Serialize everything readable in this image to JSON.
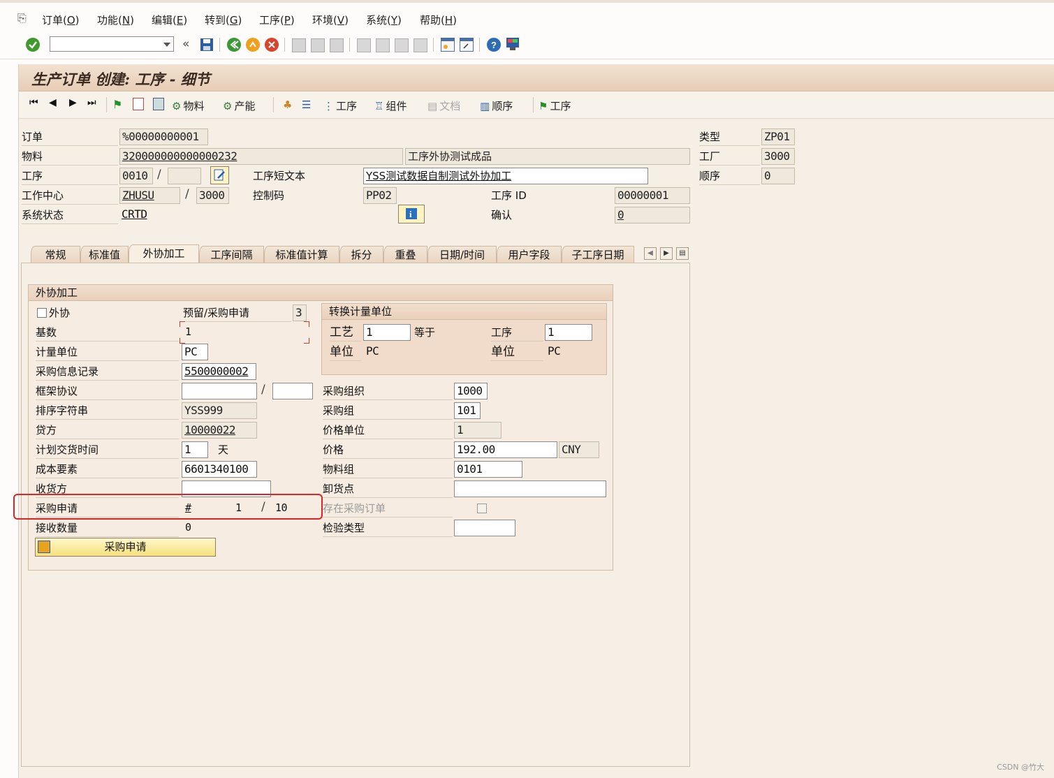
{
  "menu": {
    "items": [
      {
        "label": "订单(",
        "key": "O",
        "tail": ")"
      },
      {
        "label": "功能(",
        "key": "N",
        "tail": ")"
      },
      {
        "label": "编辑(",
        "key": "E",
        "tail": ")"
      },
      {
        "label": "转到(",
        "key": "G",
        "tail": ")"
      },
      {
        "label": "工序(",
        "key": "P",
        "tail": ")"
      },
      {
        "label": "环境(",
        "key": "V",
        "tail": ")"
      },
      {
        "label": "系统(",
        "key": "Y",
        "tail": ")"
      },
      {
        "label": "帮助(",
        "key": "H",
        "tail": ")"
      }
    ]
  },
  "command_field": {
    "value": ""
  },
  "title": "生产订单 创建: 工序 - 细节",
  "app_toolbar": {
    "material": "物料",
    "capacity": "产能",
    "operation": "工序",
    "component": "组件",
    "document": "文档",
    "sequence": "顺序",
    "operation2": "工序"
  },
  "header": {
    "order_label": "订单",
    "order_value": "%00000000001",
    "material_label": "物料",
    "material_value": "320000000000000232",
    "material_desc": "工序外协测试成品",
    "operation_label": "工序",
    "operation_value": "0010",
    "suboperation_value": "",
    "short_text_label": "工序短文本",
    "short_text_value": "YSS测试数据自制测试外协加工",
    "workcenter_label": "工作中心",
    "workcenter_value": "ZHUSU",
    "plant_value_wc": "3000",
    "control_key_label": "控制码",
    "control_key_value": "PP02",
    "op_id_label": "工序 ID",
    "op_id_value": "00000001",
    "status_label": "系统状态",
    "status_value": "CRTD",
    "confirm_label": "确认",
    "confirm_value": "0",
    "type_label": "类型",
    "type_value": "ZP01",
    "plant_label": "工厂",
    "plant_value": "3000",
    "sequence_label": "顺序",
    "sequence_value": "0"
  },
  "tabs": [
    "常规",
    "标准值",
    "外协加工",
    "工序间隔",
    "标准值计算",
    "拆分",
    "重叠",
    "日期/时间",
    "用户字段",
    "子工序日期"
  ],
  "outsourcing": {
    "group_title": "外协加工",
    "external_label": "外协",
    "reservation_label": "预留/采购申请",
    "reservation_value": "3",
    "base_qty_label": "基数",
    "base_qty_value": "1",
    "uom_label": "计量单位",
    "uom_value": "PC",
    "info_record_label": "采购信息记录",
    "info_record_value": "5500000002",
    "outline_label": "框架协议",
    "outline_value": "",
    "outline_item": "",
    "sort_label": "排序字符串",
    "sort_value": "YSS999",
    "vendor_label": "贷方",
    "vendor_value": "10000022",
    "delivery_label": "计划交货时间",
    "delivery_value": "1",
    "delivery_unit": "天",
    "cost_element_label": "成本要素",
    "cost_element_value": "6601340100",
    "recipient_label": "收货方",
    "recipient_value": "",
    "pr_label": "采购申请",
    "pr_hash": "#",
    "pr_number": "1",
    "pr_item": "10",
    "received_label": "接收数量",
    "received_value": "0",
    "pr_button": "采购申请",
    "conv_title": "转换计量单位",
    "conv_craft_label": "工艺",
    "conv_craft_value": "1",
    "conv_equal": "等于",
    "conv_op_label": "工序",
    "conv_op_value": "1",
    "conv_unit_label": "单位",
    "conv_unit_value": "PC",
    "conv_unit2_label": "单位",
    "conv_unit2_value": "PC",
    "purch_org_label": "采购组织",
    "purch_org_value": "1000",
    "purch_group_label": "采购组",
    "purch_group_value": "101",
    "price_unit_label": "价格单位",
    "price_unit_value": "1",
    "price_label": "价格",
    "price_value": "192.00",
    "currency_value": "CNY",
    "mat_group_label": "物料组",
    "mat_group_value": "0101",
    "unloading_label": "卸货点",
    "unloading_value": "",
    "po_exists_label": "存在采购订单",
    "inspection_label": "检验类型",
    "inspection_value": ""
  },
  "watermark": "CSDN @竹大"
}
